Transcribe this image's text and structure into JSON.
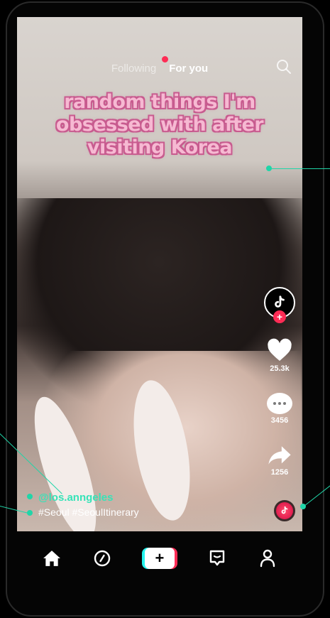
{
  "topnav": {
    "following": "Following",
    "for_you": "For you"
  },
  "video": {
    "caption_lines": [
      "random things I'm",
      "obsessed with after",
      "visiting Korea"
    ],
    "username": "@los.anngeles",
    "hashtags": [
      "#Seoul",
      "#SeoulItinerary"
    ]
  },
  "actions": {
    "likes": "25.3k",
    "comments": "3456",
    "shares": "1256"
  },
  "icons": {
    "search": "search-icon",
    "like": "heart-icon",
    "comment": "comment-icon",
    "share": "share-icon",
    "home": "home-icon",
    "discover": "compass-icon",
    "create": "plus-icon",
    "inbox": "inbox-icon",
    "profile": "person-icon"
  },
  "colors": {
    "accent_pink": "#fe2c55",
    "accent_cyan": "#25f4ee",
    "username": "#36e3b8",
    "callout": "#20d5a8"
  }
}
